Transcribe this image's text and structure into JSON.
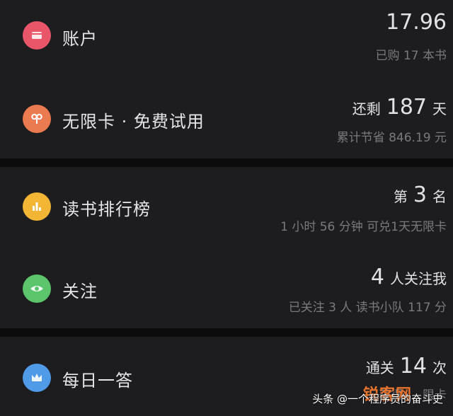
{
  "account": {
    "icon": "wallet-icon",
    "color": "#e9566a",
    "label": "账户",
    "balance": "17.96",
    "purchased": "已购 17 本书"
  },
  "unlimited": {
    "icon": "infinity-icon",
    "color": "#ea7a4f",
    "label": "无限卡 · 免费试用",
    "prefix": "还剩",
    "days": "187",
    "suffix": "天",
    "saved": "累计节省 846.19 元"
  },
  "ranking": {
    "icon": "bar-chart-icon",
    "color": "#f3b634",
    "label": "读书排行榜",
    "prefix": "第",
    "rank": "3",
    "suffix": "名",
    "detail": "1 小时 56 分钟 可兑1天无限卡"
  },
  "follow": {
    "icon": "eye-icon",
    "color": "#5cc56b",
    "label": "关注",
    "count": "4",
    "suffix": "人关注我",
    "detail": "已关注 3 人 读书小队 117 分"
  },
  "quiz": {
    "icon": "crown-icon",
    "color": "#4f9be8",
    "label": "每日一答",
    "prefix": "通关",
    "count": "14",
    "suffix": "次",
    "detail": "获得 … 限卡"
  },
  "watermark": {
    "text": "头条 @一个程序员的奋斗史",
    "brand": "锐客网"
  }
}
